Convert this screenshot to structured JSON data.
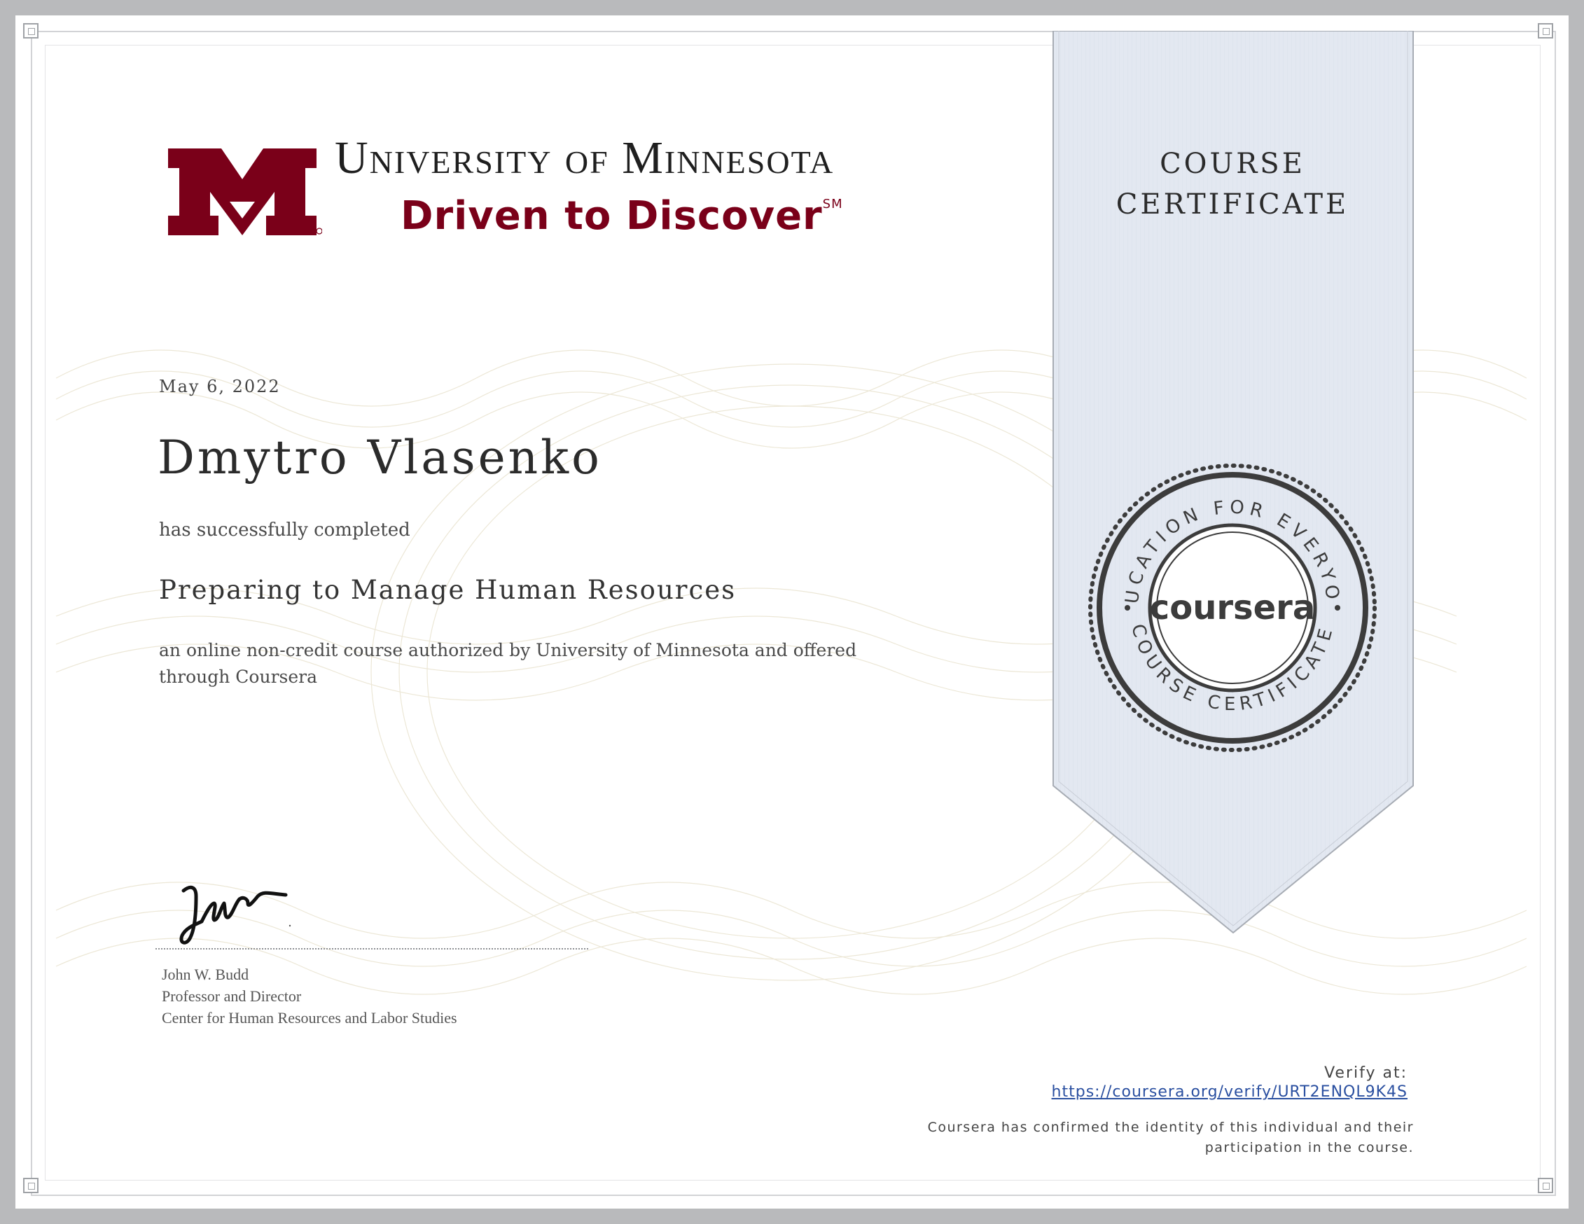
{
  "university": {
    "name": "University of Minnesota",
    "tagline": "Driven to Discover",
    "tagline_mark": "SM",
    "logo_icon": "university-m-logo-icon",
    "brand_color": "#7a0019"
  },
  "ribbon": {
    "title_line1": "COURSE",
    "title_line2": "CERTIFICATE",
    "color": "#e3e8f1"
  },
  "seal": {
    "top_text": "EDUCATION FOR EVERYONE",
    "bottom_text": "COURSE CERTIFICATE",
    "center_text": "coursera",
    "color": "#3c3c3c"
  },
  "certificate": {
    "date": "May 6, 2022",
    "recipient": "Dmytro Vlasenko",
    "completed_text": "has successfully completed",
    "course_title": "Preparing to Manage Human Resources",
    "description": "an online non-credit course authorized by University of Minnesota and offered through Coursera"
  },
  "signer": {
    "name": "John W. Budd",
    "title": "Professor and Director",
    "department": "Center for Human Resources and Labor Studies",
    "signature_icon": "handwritten-signature-icon"
  },
  "verify": {
    "label": "Verify at:",
    "url": "https://coursera.org/verify/URT2ENQL9K4S",
    "confirmation": "Coursera has confirmed the identity of this individual and their participation in the course.",
    "link_color": "#2a4fa0"
  }
}
